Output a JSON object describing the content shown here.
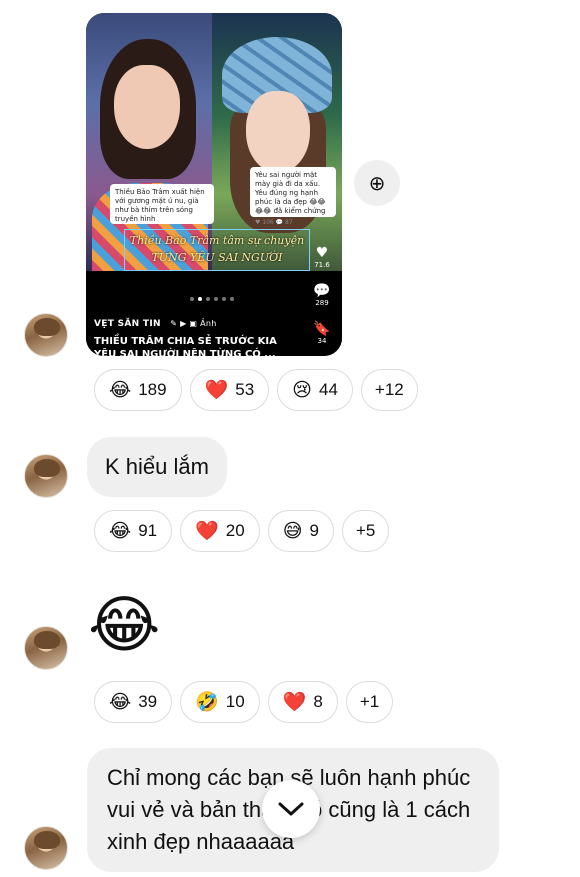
{
  "messages": [
    {
      "type": "reel",
      "reel": {
        "left_caption": "Thiều Bảo Trâm xuất hiện với gương mặt ú nu, già như bà thím trên sóng truyền hình",
        "right_caption": "Yêu sai người mặt mày già đi da xấu. Yêu đúng ng hạnh phúc là da đẹp 😂😂😂😂 đã kiểm chứng",
        "right_caption_meta": "♥ 106   💬 87",
        "overlay_title": "Thiều Bảo Trâm tâm sự chuyện TỪNG YÊU SAI NGƯỜI",
        "source": "VẸT SĂN TIN",
        "source_tag": "Ảnh",
        "title": "THIỀU TRÂM CHIA SẺ TRƯỚC KIA YÊU SAI NGƯỜI NÊN TỪNG CÓ ...",
        "likes": "71.6",
        "comments": "289",
        "saves": "34"
      },
      "reactions": [
        {
          "emoji": "😂",
          "count": "189"
        },
        {
          "emoji": "❤️",
          "count": "53"
        },
        {
          "emoji": "😢",
          "count": "44"
        },
        {
          "emoji": "",
          "count": "+12"
        }
      ]
    },
    {
      "type": "text",
      "text": "K hiểu lắm",
      "reactions": [
        {
          "emoji": "😂",
          "count": "91"
        },
        {
          "emoji": "❤️",
          "count": "20"
        },
        {
          "emoji": "😅",
          "count": "9"
        },
        {
          "emoji": "",
          "count": "+5"
        }
      ]
    },
    {
      "type": "emoji",
      "emoji": "😂",
      "reactions": [
        {
          "emoji": "😂",
          "count": "39"
        },
        {
          "emoji": "🤣",
          "count": "10"
        },
        {
          "emoji": "❤️",
          "count": "8"
        },
        {
          "emoji": "",
          "count": "+1"
        }
      ]
    },
    {
      "type": "text",
      "text": "Chỉ mong các bạn sẽ luôn hạnh phúc vui vẻ và bản thân, đó cũng là 1 cách xinh đẹp nhaaaaaa"
    }
  ],
  "icons": {
    "share": "share-plus-icon",
    "scroll_down": "chevron-down-icon",
    "reel_like": "heart-icon",
    "reel_comment": "comment-icon",
    "reel_save": "bookmark-icon"
  }
}
